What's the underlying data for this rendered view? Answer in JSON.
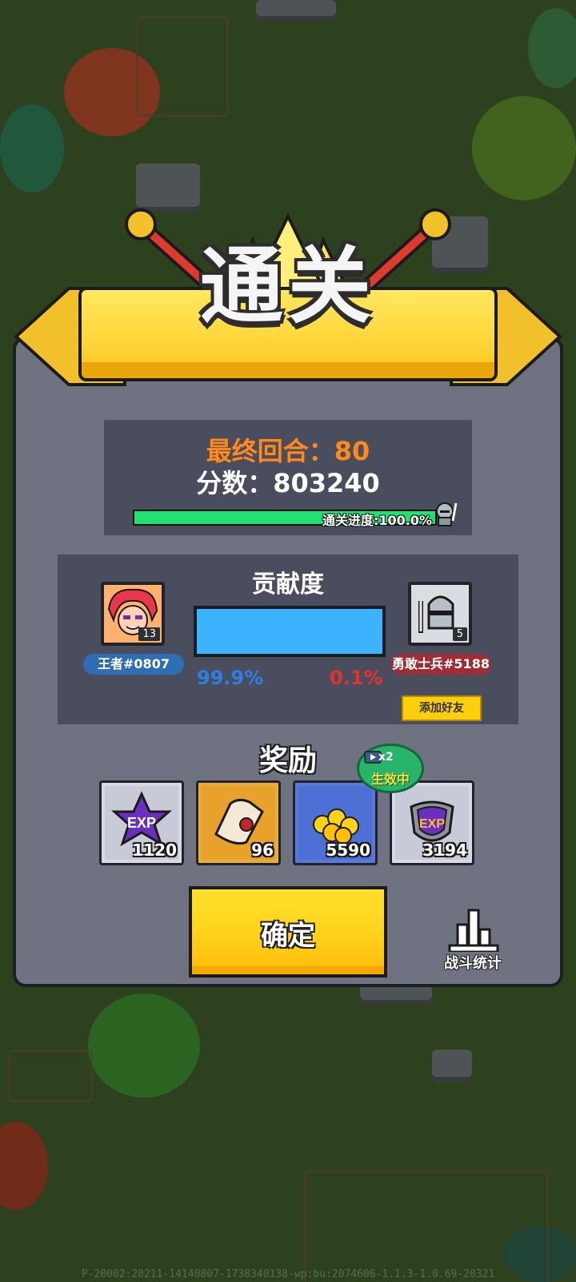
{
  "banner": {
    "title": "通关"
  },
  "summary": {
    "final_round_label": "最终回合：",
    "final_round_value": "80",
    "score_label": "分数：",
    "score_value": "803240",
    "progress_text": "通关进度:100.0%",
    "progress_fraction": 1.0
  },
  "contribution": {
    "title": "贡献度",
    "left_player": {
      "name": "王者#0807",
      "level": "13",
      "percent": "99.9%"
    },
    "right_player": {
      "name": "勇敢士兵#5188",
      "level": "5",
      "percent": "0.1%"
    },
    "bar_fraction": 0.999,
    "add_friend_label": "添加好友"
  },
  "rewards": {
    "title": "奖励",
    "badge": {
      "multiplier": "x2",
      "status": "生效中"
    },
    "items": [
      {
        "icon": "exp-star-icon",
        "count": "1120"
      },
      {
        "icon": "scroll-icon",
        "count": "96"
      },
      {
        "icon": "gold-coins-icon",
        "count": "5590"
      },
      {
        "icon": "exp-shield-icon",
        "count": "3194"
      }
    ]
  },
  "actions": {
    "confirm_label": "确定",
    "battle_stats_label": "战斗统计"
  },
  "footer": {
    "build_text": "P-20002:20211-14140807-1738340138-wp:bu:2074606-1.1.3-1.0.69-20321"
  },
  "colors": {
    "accent_orange": "#ff8a1a",
    "progress_green": "#22e070",
    "contribution_blue": "#3bb3ff",
    "left_percent_blue": "#2f7fe0",
    "right_percent_red": "#e5312d",
    "banner_yellow": "#ffd73b"
  }
}
